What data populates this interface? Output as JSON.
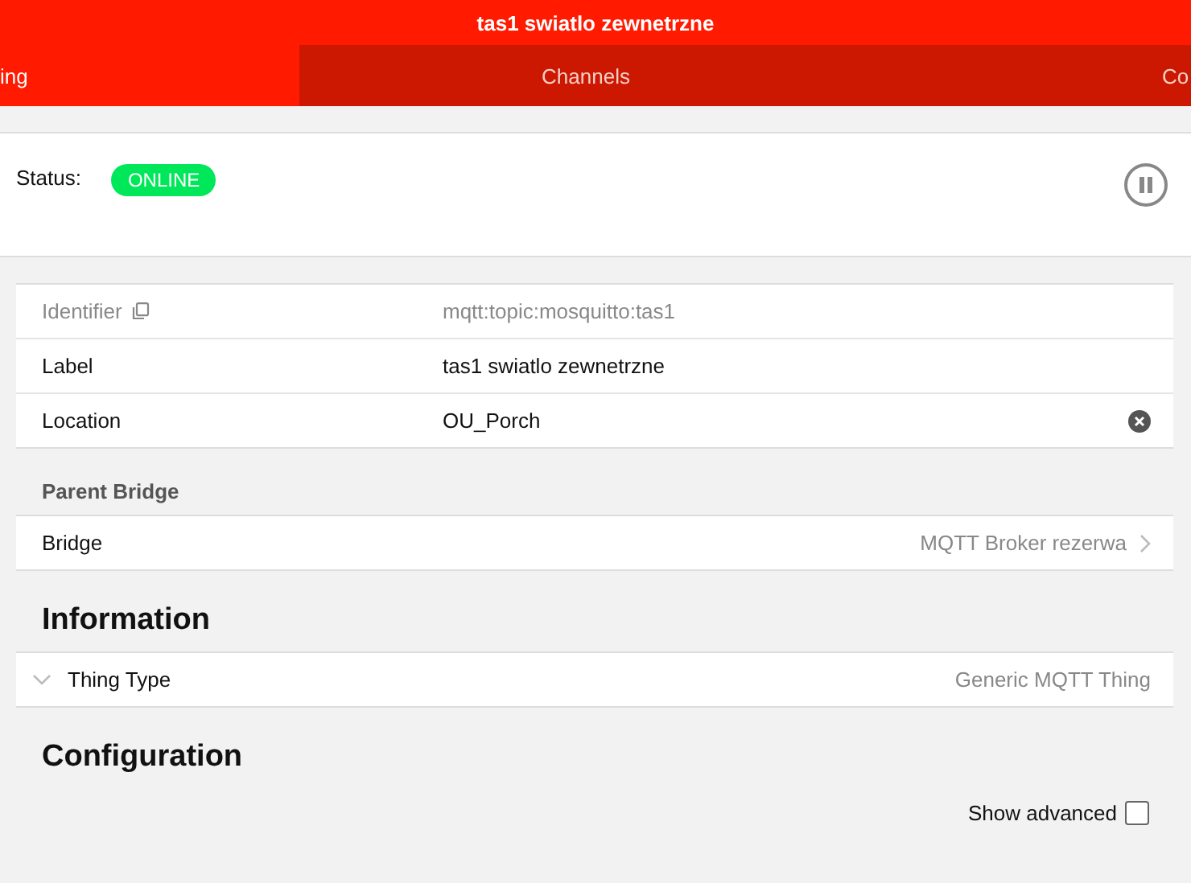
{
  "header": {
    "title": "tas1 swiatlo zewnetrzne"
  },
  "tabs": [
    {
      "label": "ing",
      "selected": true
    },
    {
      "label": "Channels",
      "selected": false
    },
    {
      "label": "Co",
      "selected": false
    }
  ],
  "status": {
    "label": "Status:",
    "value": "ONLINE",
    "paused": false
  },
  "properties": [
    {
      "kind": "identifier",
      "label": "Identifier",
      "value": "mqtt:topic:mosquitto:tas1"
    },
    {
      "kind": "text",
      "label": "Label",
      "value": "tas1 swiatlo zewnetrzne"
    },
    {
      "kind": "clearable",
      "label": "Location",
      "value": "OU_Porch"
    }
  ],
  "parent_bridge": {
    "heading": "Parent Bridge",
    "label": "Bridge",
    "value": "MQTT Broker rezerwa"
  },
  "information": {
    "heading": "Information",
    "thing_type": {
      "label": "Thing Type",
      "value": "Generic MQTT Thing",
      "expanded": false
    }
  },
  "configuration": {
    "heading": "Configuration",
    "show_advanced": {
      "label": "Show advanced",
      "checked": false
    }
  }
}
